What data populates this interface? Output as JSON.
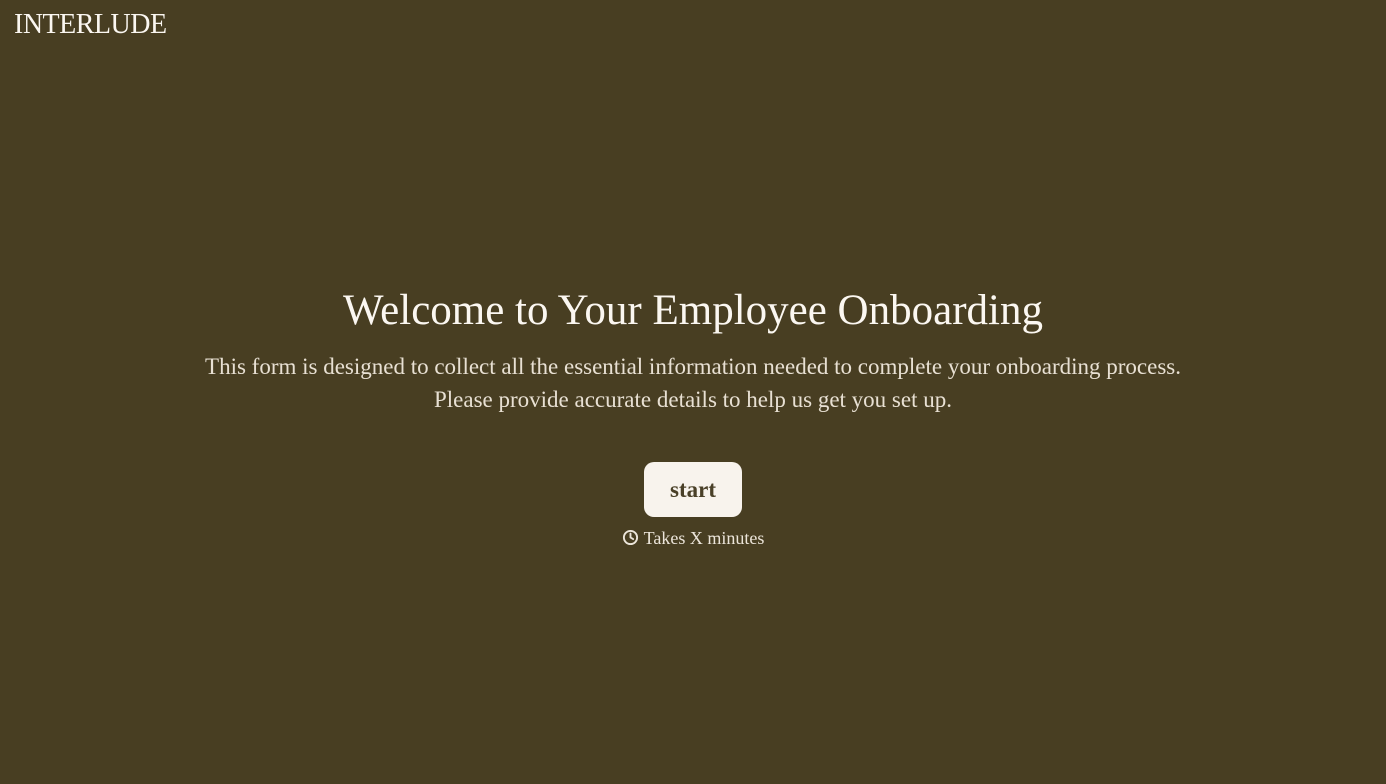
{
  "brand": {
    "name": "INTERLUDE"
  },
  "welcome": {
    "title": "Welcome to Your Employee Onboarding",
    "description": "This form is designed to collect all the essential information needed to complete your onboarding process. Please provide accurate details to help us get you set up.",
    "start_label": "start",
    "duration_text": "Takes X minutes",
    "duration_icon": "clock-icon"
  },
  "colors": {
    "background": "#483e22",
    "button_background": "#f8f3ed",
    "button_text": "#4a4028",
    "text": "#f7f2ea"
  }
}
